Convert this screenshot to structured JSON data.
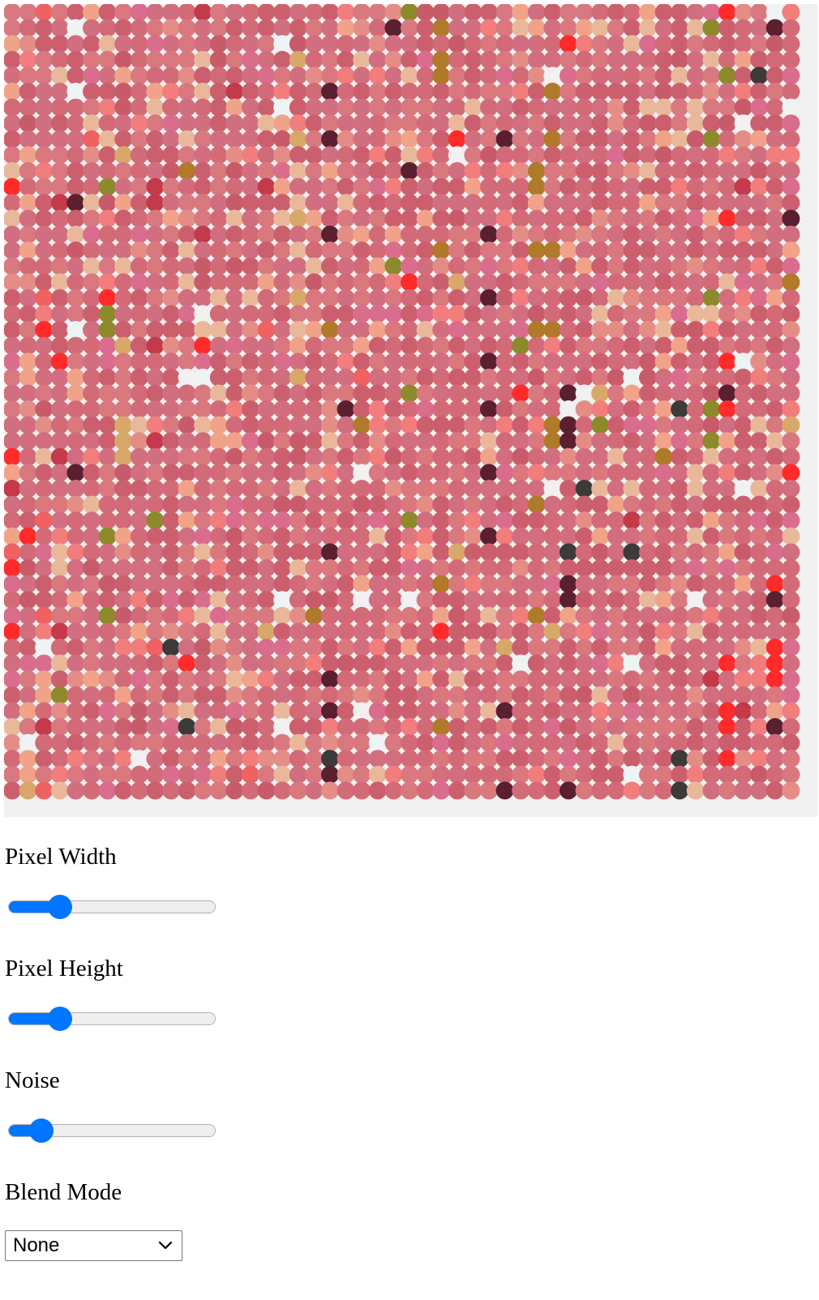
{
  "artwork": {
    "palette": [
      "#d16e7f",
      "#d36a78",
      "#cc5f6e",
      "#d9787f",
      "#e48d86",
      "#f0a388",
      "#e9b89a",
      "#c85b6a",
      "#da6d8e",
      "#f17d7d",
      "#f06161",
      "#ff2b2b",
      "#f2f0f0",
      "#eef4f4",
      "#5a2030",
      "#3d3a3a",
      "#b07a2a",
      "#8c8a2a",
      "#d8a86a",
      "#c43a4a"
    ]
  },
  "controls": {
    "pixel_width": {
      "label": "Pixel Width",
      "value": 0.25
    },
    "pixel_height": {
      "label": "Pixel Height",
      "value": 0.25
    },
    "noise": {
      "label": "Noise",
      "value": 0.16
    },
    "blend_mode": {
      "label": "Blend Mode",
      "selected": "None"
    }
  }
}
